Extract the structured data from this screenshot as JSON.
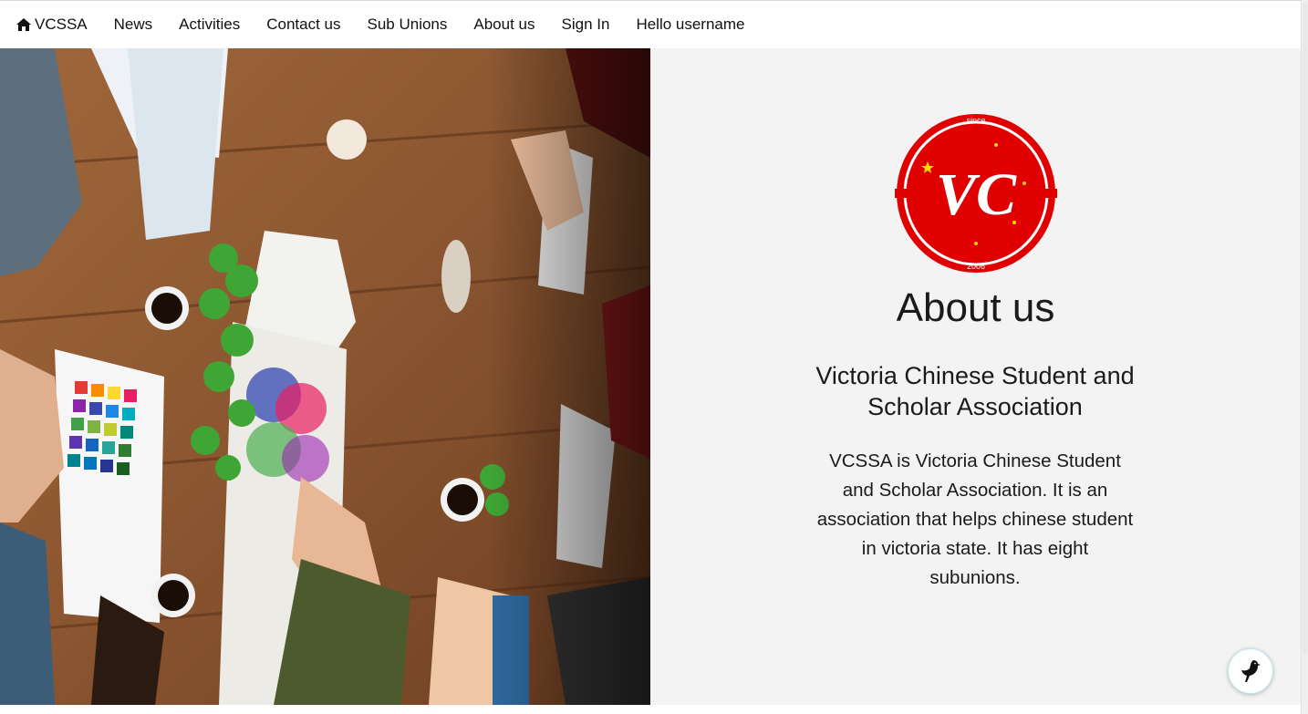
{
  "nav": {
    "brand": "VCSSA",
    "items": [
      "News",
      "Activities",
      "Contact us",
      "Sub Unions",
      "About us",
      "Sign In",
      "Hello username"
    ]
  },
  "logo": {
    "initials": "VC",
    "top_text": "since",
    "bottom_text": "2006",
    "color": "#e00000"
  },
  "about": {
    "title": "About us",
    "subtitle": "Victoria Chinese Student and Scholar Association",
    "description": "VCSSA is Victoria Chinese Student and Scholar Association. It is an association that helps chinese student in victoria state. It has eight subunions."
  },
  "icons": {
    "brand": "home-icon",
    "fab": "bird-icon",
    "photo": "team-meeting-photo"
  }
}
